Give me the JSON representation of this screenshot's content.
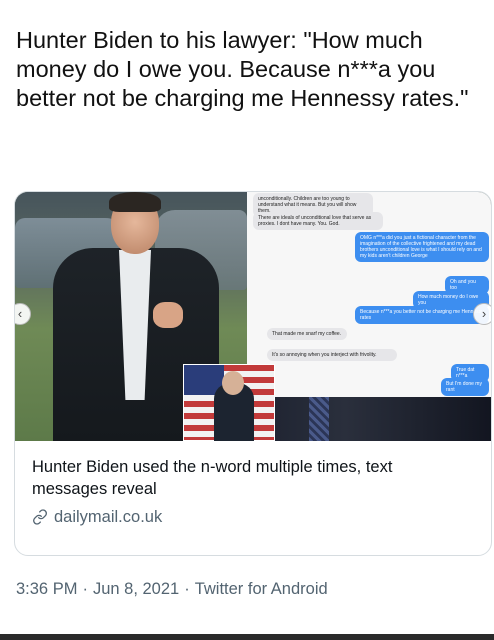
{
  "tweet": {
    "text": "Hunter Biden to his lawyer: \"How much money do I owe you. Because n***a you better not be charging me Hennessy rates.\""
  },
  "card": {
    "title": "Hunter Biden used the n-word multiple times, text messages reveal",
    "domain": "dailymail.co.uk",
    "link_icon": "link-icon",
    "messages": [
      {
        "dir": "in",
        "text": "unconditionally. Children are too young to understand what it means. But you will show them."
      },
      {
        "dir": "in",
        "text": "There are ideals of unconditional love that serve as proxies. I dont have many. You. God."
      },
      {
        "dir": "out",
        "text": "OMG n***a did you just a fictional character from the imagination of the collective frightened and my dead brothers unconditional love is what I should rely on and my kids aren't children George"
      },
      {
        "dir": "out",
        "text": "Oh and you too"
      },
      {
        "dir": "out",
        "text": "How much money do I owe you"
      },
      {
        "dir": "out",
        "text": "Because n***a you better not be charging me Hennessy rates"
      },
      {
        "dir": "in",
        "text": "That made me snarf my coffee."
      },
      {
        "dir": "in",
        "text": "It's so annoying when you interject with frivolity."
      },
      {
        "dir": "out",
        "text": "True dat n***a"
      },
      {
        "dir": "out",
        "text": "But I'm done my rant"
      }
    ]
  },
  "meta": {
    "time": "3:36 PM",
    "date": "Jun 8, 2021",
    "source": "Twitter for Android",
    "separator": "·"
  },
  "icons": {
    "prev": "‹",
    "next": "›",
    "link": "🔗"
  }
}
